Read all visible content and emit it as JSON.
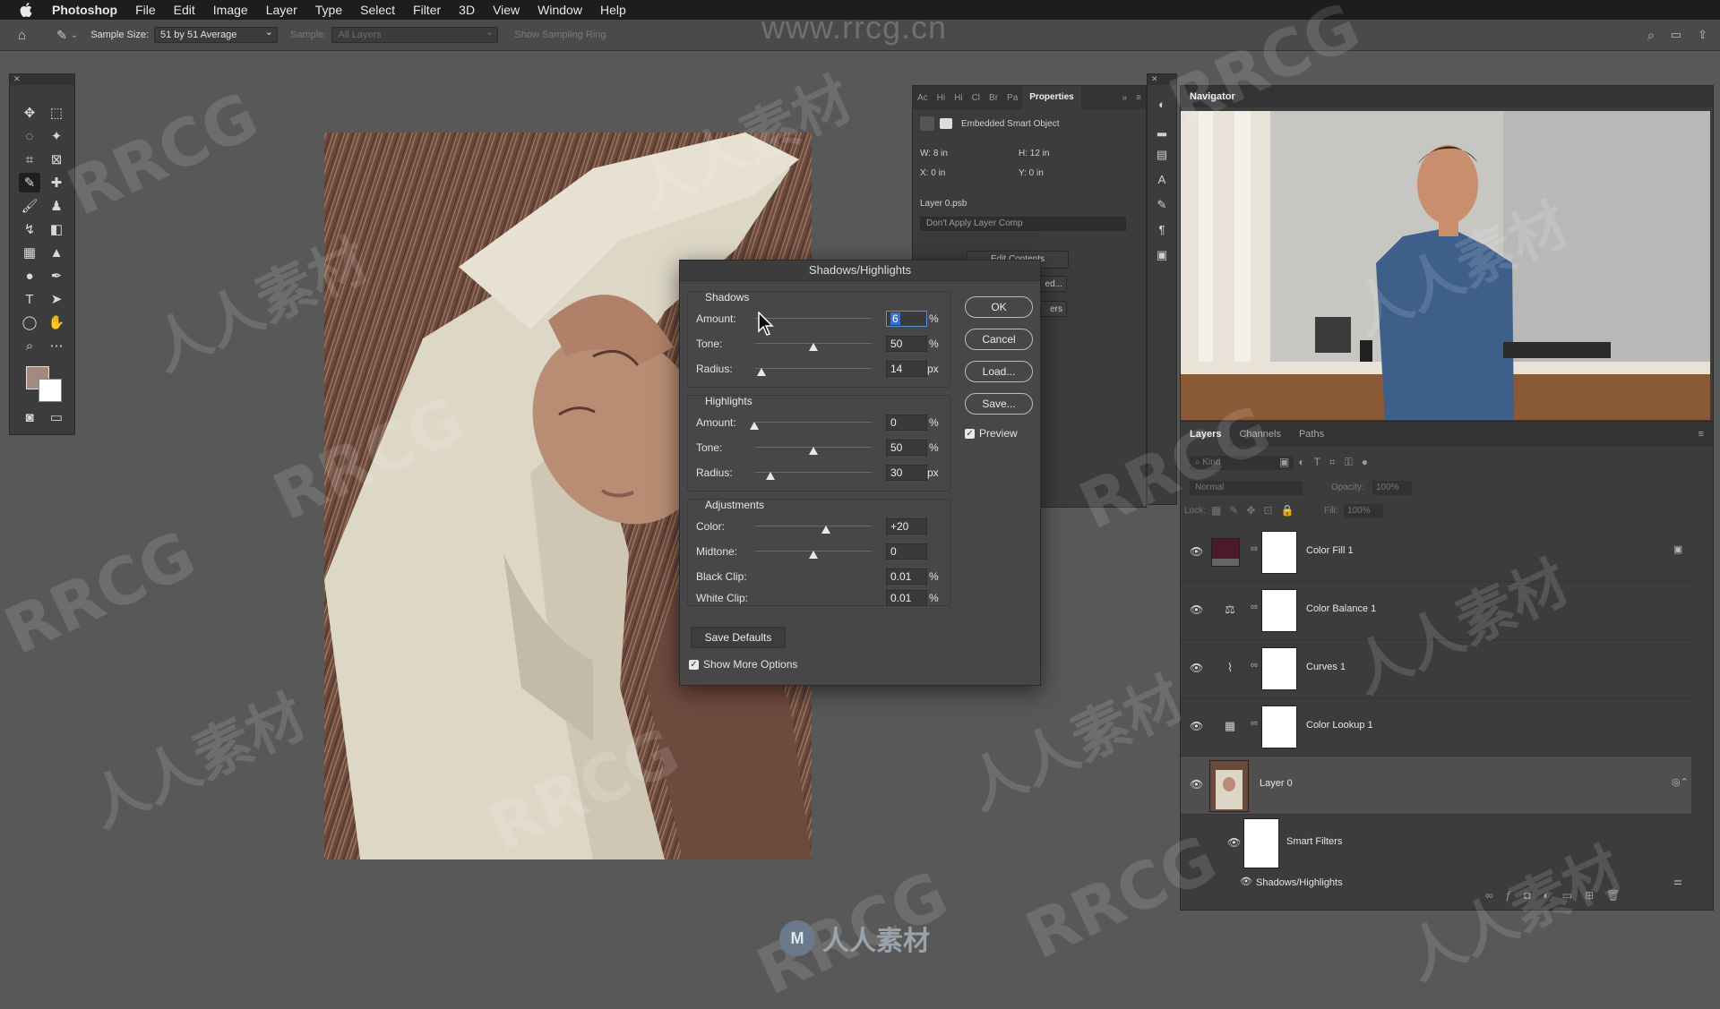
{
  "menubar": {
    "app": "Photoshop",
    "items": [
      "File",
      "Edit",
      "Image",
      "Layer",
      "Type",
      "Select",
      "Filter",
      "3D",
      "View",
      "Window",
      "Help"
    ]
  },
  "options": {
    "sample_size_label": "Sample Size:",
    "sample_size_value": "51 by 51 Average",
    "sample_label": "Sample:",
    "sample_value": "All Layers",
    "sampling_ring": "Show Sampling Ring"
  },
  "watermark": {
    "url": "www.rrcg.cn",
    "text": "RRCG",
    "cn": "人人素材",
    "bottom_logo": "人人素材"
  },
  "properties": {
    "tabs": [
      "Ac",
      "Hi",
      "Hi",
      "Cl",
      "Br",
      "Pa",
      "Properties"
    ],
    "type": "Embedded Smart Object",
    "w": "W:  8 in",
    "h": "H:  12 in",
    "x": "X:   0 in",
    "y": "Y:   0 in",
    "file": "Layer 0.psb",
    "comp": "Don't Apply Layer Comp",
    "edit_contents": "Edit Contents",
    "btn2": "ed...",
    "btn3": "ers"
  },
  "navigator": {
    "title": "Navigator"
  },
  "layers_panel": {
    "tabs": [
      "Layers",
      "Channels",
      "Paths"
    ],
    "kind": "Kind",
    "blend": "Normal",
    "opacity_label": "Opacity:",
    "opacity_value": "100%",
    "lock_label": "Lock:",
    "fill_label": "Fill:",
    "fill_value": "100%",
    "layers": [
      {
        "name": "Color Fill 1",
        "icon": "color-fill-swatch"
      },
      {
        "name": "Color Balance 1",
        "icon": "balance-icon"
      },
      {
        "name": "Curves 1",
        "icon": "curves-icon"
      },
      {
        "name": "Color Lookup 1",
        "icon": "grid-icon"
      },
      {
        "name": "Layer 0",
        "icon": "photo-thumbnail"
      }
    ],
    "smart_filters": "Smart Filters",
    "filter_name": "Shadows/Highlights",
    "fill_color": "#4a1a2c"
  },
  "dialog": {
    "title": "Shadows/Highlights",
    "shadows": {
      "title": "Shadows",
      "amount_label": "Amount:",
      "amount": "6",
      "amount_unit": "%",
      "tone_label": "Tone:",
      "tone": "50",
      "tone_unit": "%",
      "radius_label": "Radius:",
      "radius": "14",
      "radius_unit": "px"
    },
    "highlights": {
      "title": "Highlights",
      "amount_label": "Amount:",
      "amount": "0",
      "amount_unit": "%",
      "tone_label": "Tone:",
      "tone": "50",
      "tone_unit": "%",
      "radius_label": "Radius:",
      "radius": "30",
      "radius_unit": "px"
    },
    "adjustments": {
      "title": "Adjustments",
      "color_label": "Color:",
      "color": "+20",
      "midtone_label": "Midtone:",
      "midtone": "0",
      "black_label": "Black Clip:",
      "black": "0.01",
      "black_unit": "%",
      "white_label": "White Clip:",
      "white": "0.01",
      "white_unit": "%"
    },
    "buttons": {
      "ok": "OK",
      "cancel": "Cancel",
      "load": "Load...",
      "save": "Save..."
    },
    "preview": "Preview",
    "save_defaults": "Save Defaults",
    "show_more": "Show More Options"
  }
}
